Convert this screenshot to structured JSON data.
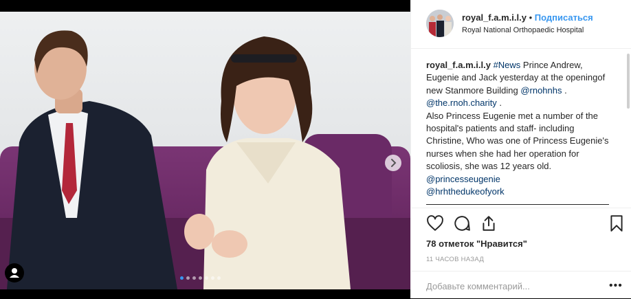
{
  "header": {
    "username": "royal_f.a.m.i.l.y",
    "separator": "•",
    "follow_label": "Подписаться",
    "location": "Royal National Orthopaedic Hospital"
  },
  "caption": {
    "username": "royal_f.a.m.i.l.y",
    "hashtag": "#News",
    "text1": " Prince Andrew, Eugenie and Jack yesterday at the openingof new Stanmore Building ",
    "mention1": "@rnohnhs",
    "sep1": " . ",
    "mention2": "@the.rnoh.charity",
    "sep2": " .",
    "text2": "Also Princess Eugenie met a number of the hospital's patients and staff- including Christine, Who was one of Princess Eugenie's nurses when she had her operation for scoliosis, she was 12 years old. ",
    "mention3": "@princesseugenie",
    "mention4": "@hrhthedukeofyork"
  },
  "actions": {
    "like_icon": "heart-icon",
    "comment_icon": "comment-icon",
    "share_icon": "share-icon",
    "save_icon": "bookmark-icon"
  },
  "likes_text": "78 отметок \"Нравится\"",
  "time_text": "11 часов назад",
  "comment": {
    "placeholder": "Добавьте комментарий...",
    "more_label": "•••"
  },
  "carousel": {
    "slide_count": 7,
    "active_index": 0
  },
  "colors": {
    "accent": "#3897f0",
    "link": "#003569",
    "purple_sofa": "#6b2a64"
  }
}
